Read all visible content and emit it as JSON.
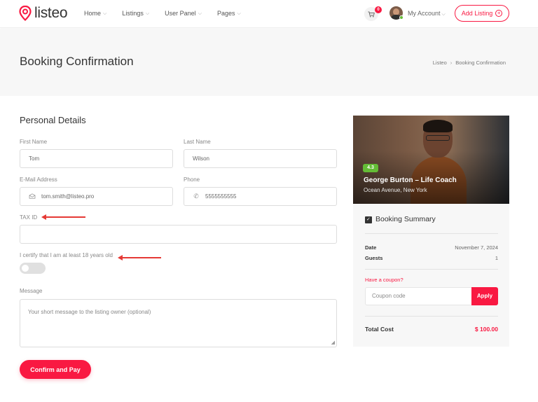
{
  "header": {
    "logo_text": "listeo",
    "nav": [
      {
        "label": "Home"
      },
      {
        "label": "Listings"
      },
      {
        "label": "User Panel"
      },
      {
        "label": "Pages"
      }
    ],
    "cart_count": "0",
    "account_label": "My Account",
    "add_listing_label": "Add Listing"
  },
  "titlebar": {
    "title": "Booking Confirmation",
    "breadcrumb": [
      "Listeo",
      "Booking Confirmation"
    ]
  },
  "form": {
    "section_title": "Personal Details",
    "first_name": {
      "label": "First Name",
      "value": "Tom"
    },
    "last_name": {
      "label": "Last Name",
      "value": "Wilson"
    },
    "email": {
      "label": "E-Mail Address",
      "value": "tom.smith@listeo.pro"
    },
    "phone": {
      "label": "Phone",
      "value": "5555555555"
    },
    "tax_id": {
      "label": "TAX ID",
      "value": ""
    },
    "age_certify": {
      "label": "I certify that I am at least 18 years old",
      "checked": false
    },
    "message": {
      "label": "Message",
      "placeholder": "Your short message to the listing owner (optional)"
    },
    "confirm_label": "Confirm and Pay"
  },
  "listing": {
    "rating": "4.3",
    "name": "George Burton – Life Coach",
    "location": "Ocean Avenue, New York"
  },
  "summary": {
    "title": "Booking Summary",
    "date_label": "Date",
    "date_value": "November 7, 2024",
    "guests_label": "Guests",
    "guests_value": "1",
    "coupon_link": "Have a coupon?",
    "coupon_placeholder": "Coupon code",
    "apply_label": "Apply",
    "total_label": "Total Cost",
    "total_value": "$ 100.00"
  },
  "colors": {
    "accent": "#f91942",
    "rating_green": "#64bc36",
    "annotation_arrow": "#e53935"
  }
}
